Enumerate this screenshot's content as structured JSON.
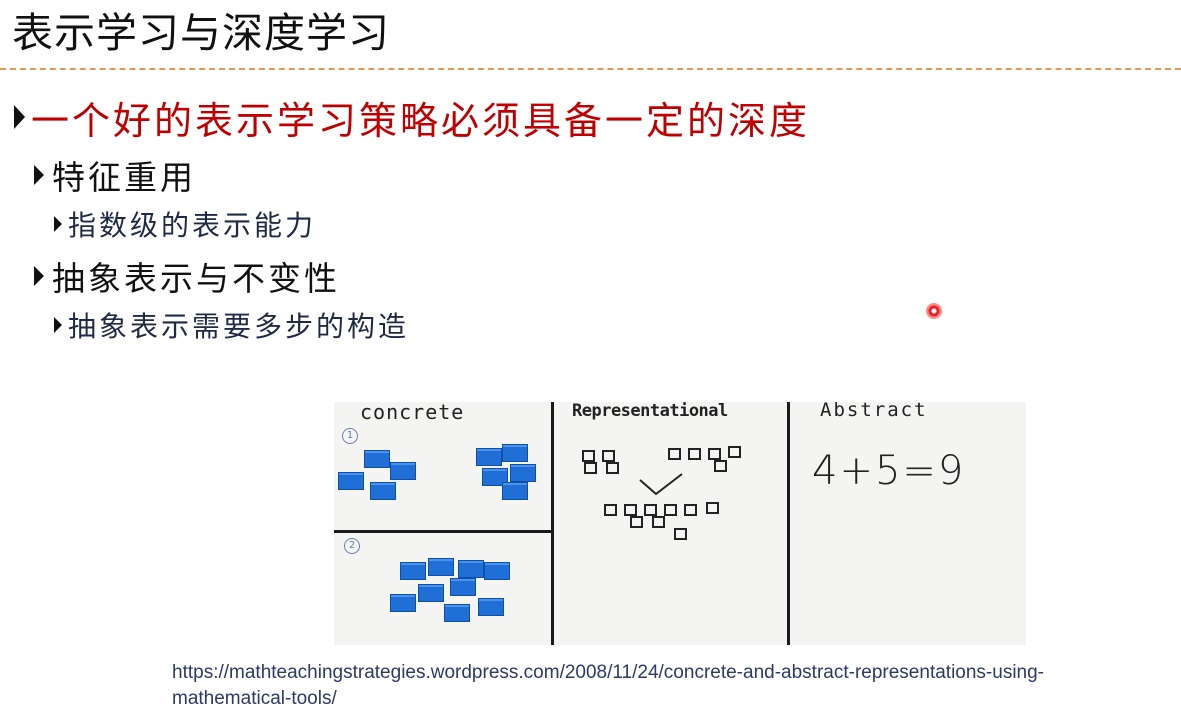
{
  "slide": {
    "title": "表示学习与深度学习",
    "bullets": {
      "level1": "一个好的表示学习策略必须具备一定的深度",
      "item1": "特征重用",
      "item1_sub": "指数级的表示能力",
      "item2": "抽象表示与不变性",
      "item2_sub": "抽象表示需要多步的构造"
    },
    "image": {
      "col1_heading": "concrete",
      "col2_heading": "Representational",
      "col3_heading": "Abstract",
      "equation": "4+5=9",
      "row_marks": [
        "①",
        "②"
      ]
    },
    "source_url": "https://mathteachingstrategies.wordpress.com/2008/11/24/concrete-and-abstract-representations-using-mathematical-tools/"
  },
  "colors": {
    "title_text": "#111111",
    "heading_red": "#c00000",
    "rule_orange": "#e39a55",
    "subtext_navy": "#1f2a44",
    "cube_blue": "#1f6fd6",
    "pointer_red": "#e8202a"
  },
  "icons": [
    "bullet-triangle-icon",
    "laser-pointer-icon"
  ]
}
